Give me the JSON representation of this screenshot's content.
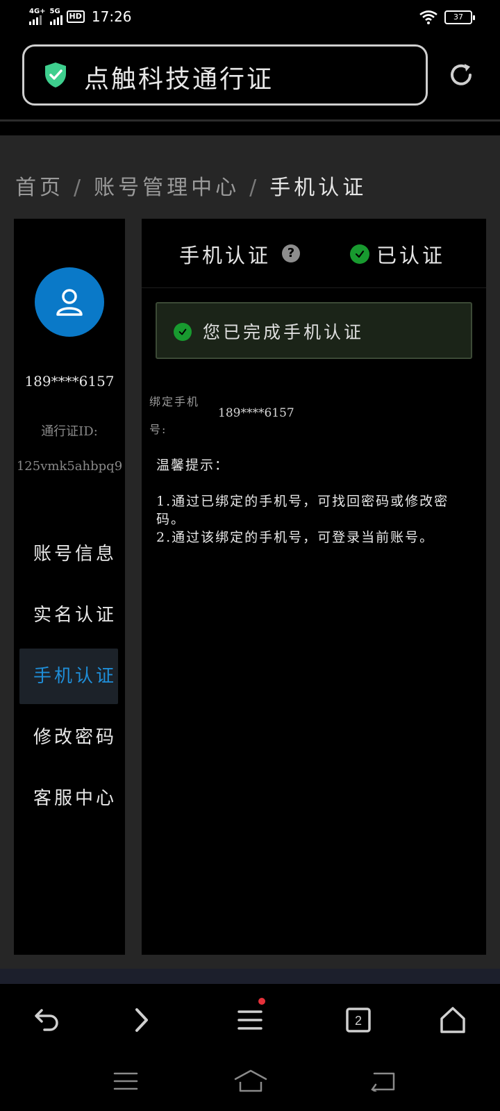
{
  "status_bar": {
    "net1": "4G+",
    "net2": "5G",
    "hd": "HD",
    "time": "17:26",
    "battery": "37"
  },
  "browser": {
    "address_title": "点触科技通行证",
    "tab_count": "2"
  },
  "breadcrumb": {
    "home": "首页",
    "sep1": "/",
    "account": "账号管理中心",
    "sep2": "/",
    "current": "手机认证"
  },
  "sidebar": {
    "phone": "189****6157",
    "passport_label": "通行证ID:",
    "passport_id": "125vmk5ahbpq9",
    "items": [
      {
        "label": "账号信息",
        "active": false
      },
      {
        "label": "实名认证",
        "active": false
      },
      {
        "label": "手机认证",
        "active": true
      },
      {
        "label": "修改密码",
        "active": false
      },
      {
        "label": "客服中心",
        "active": false
      }
    ]
  },
  "main": {
    "title": "手机认证",
    "help": "?",
    "status": "已认证",
    "alert": "您已完成手机认证",
    "bind_label": "绑定手机号:",
    "bind_phone": "189****6157",
    "tips_title": "温馨提示：",
    "tips": [
      "1.通过已绑定的手机号，可找回密码或修改密码。",
      "2.通过该绑定的手机号，可登录当前账号。"
    ]
  },
  "colors": {
    "accent_blue": "#1f8ed8",
    "avatar_blue": "#0a79c8",
    "success_green": "#189a2f",
    "shield_green": "#3ecf8e"
  },
  "icons": [
    "shield-check-icon",
    "reload-icon",
    "user-icon",
    "help-icon",
    "check-circle-icon",
    "back-arrow-icon",
    "forward-arrow-icon",
    "menu-icon",
    "tabs-icon",
    "home-icon"
  ]
}
